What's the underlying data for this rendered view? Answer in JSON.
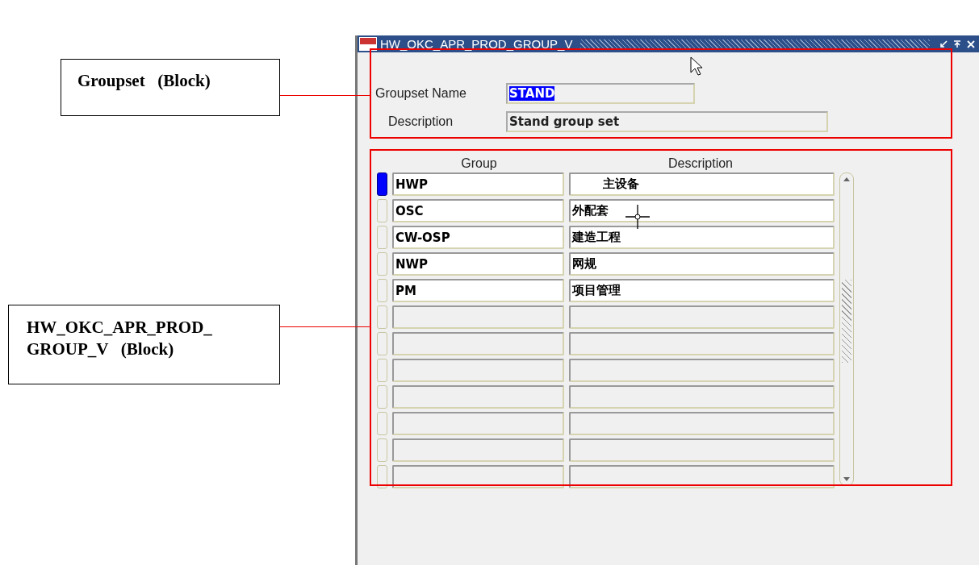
{
  "annotations": [
    {
      "lines": [
        "Groupset   (Block)"
      ]
    },
    {
      "lines": [
        "HW_OKC_APR_PROD_",
        "GROUP_V   (Block)"
      ]
    }
  ],
  "window": {
    "title": "HW_OKC_APR_PROD_GROUP_V"
  },
  "groupset": {
    "fields": [
      {
        "label": "Groupset Name",
        "value": "STAND",
        "highlighted": true
      },
      {
        "label": "Description",
        "value": "Stand group set",
        "highlighted": false
      }
    ]
  },
  "table": {
    "columns": [
      "Group",
      "Description"
    ],
    "rows": [
      {
        "selected": true,
        "group": "HWP",
        "description": "主设备"
      },
      {
        "selected": false,
        "group": "OSC",
        "description": "外配套"
      },
      {
        "selected": false,
        "group": "CW-OSP",
        "description": "建造工程"
      },
      {
        "selected": false,
        "group": "NWP",
        "description": "网规"
      },
      {
        "selected": false,
        "group": "PM",
        "description": "项目管理"
      },
      {
        "selected": false
      },
      {
        "selected": false
      },
      {
        "selected": false
      },
      {
        "selected": false
      },
      {
        "selected": false
      },
      {
        "selected": false
      },
      {
        "selected": false
      }
    ]
  }
}
